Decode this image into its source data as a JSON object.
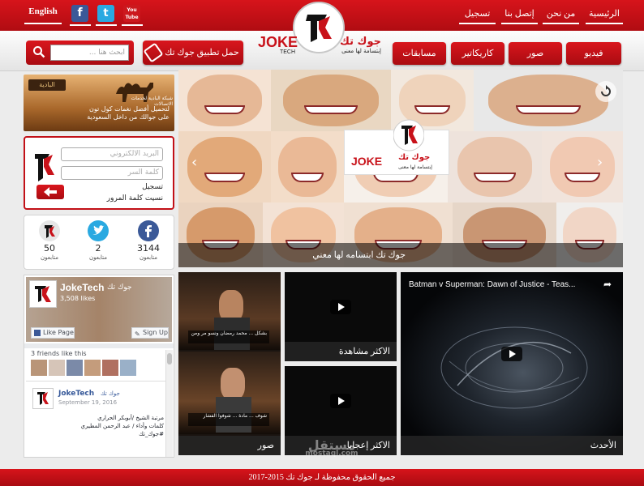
{
  "header": {
    "language_link": "English",
    "social_icons": [
      {
        "name": "facebook-icon",
        "glyph": "f",
        "color": "#3b5998"
      },
      {
        "name": "twitter-icon",
        "glyph": "t",
        "color": "#29a9e1"
      },
      {
        "name": "youtube-icon",
        "glyph": "You Tube",
        "color": "#cc181e"
      }
    ],
    "nav": [
      "الرئيسية",
      "من نحن",
      "إتصل بنا",
      "تسجيل"
    ],
    "logo": {
      "ar_name": "جوك تك",
      "en_name": "JOKE",
      "en_sub": "TECH",
      "tagline": "إبتسامة لها معنى"
    }
  },
  "category_nav": [
    "فيديو",
    "صور",
    "كاريكاتير",
    "مسابقات"
  ],
  "app_download": {
    "label": "حمل تطبيق جوك تك"
  },
  "search": {
    "placeholder": "ابحث هنا ..."
  },
  "colors": {
    "brand_red": "#c8121a",
    "facebook": "#3b5998",
    "twitter": "#29a9e1"
  },
  "ad_banner": {
    "brand": "البادية",
    "line1": "لتحميل أفضل نغمات كول تون",
    "line2": "على جوالك من داخل السعودية",
    "sub": "شبكة البادية لخدمات الاتصالات"
  },
  "login": {
    "email_placeholder": "البريد الالكتروني",
    "password_placeholder": "كلمة السر",
    "register_link": "تسجيل",
    "forgot_link": "نسيت كلمة المرور"
  },
  "social_stats": [
    {
      "network": "facebook",
      "count": "3144",
      "label": "متابعون"
    },
    {
      "network": "twitter",
      "count": "2",
      "label": "متابعون"
    },
    {
      "network": "joke-tech",
      "count": "50",
      "label": "متابعون"
    }
  ],
  "facebook_widget": {
    "page_name": "JokeTech",
    "page_name_ar": "جوك تك",
    "likes": "3,508 likes",
    "like_button": "Like Page",
    "signup_button": "Sign Up",
    "friends_text": "3 friends like this",
    "post_author": "JokeTech",
    "post_author_ar": "جوك تك",
    "post_date": "September 19, 2016",
    "post_line1": "مرتبة الشيخ /أبوبكر الحراري",
    "post_line2": "كلمات وأداء / عبد الرحمن المطيري",
    "post_line3": "#جوك_تك"
  },
  "featured": {
    "caption": "جوك تك ابتسامه لها معني"
  },
  "video_tiles": {
    "photos": "صور",
    "most_watched": "الاكثر مشاهدة",
    "most_liked": "الاكثر إعجابا",
    "latest": "الأحدث",
    "youtube_title": "Batman v Superman: Dawn of Justice - Teas...",
    "photo_text_1": "بشكل ... محمد رمضان ونسو مر ومن",
    "photo_text_2": "شوف ... مادة ... شوفوا الفشار"
  },
  "watermark": {
    "ar": "مستقل",
    "en": "mostaql.com"
  },
  "footer": {
    "copyright": "جميع الحقوق محفوظة لـ جوك تك 2015-2017"
  }
}
